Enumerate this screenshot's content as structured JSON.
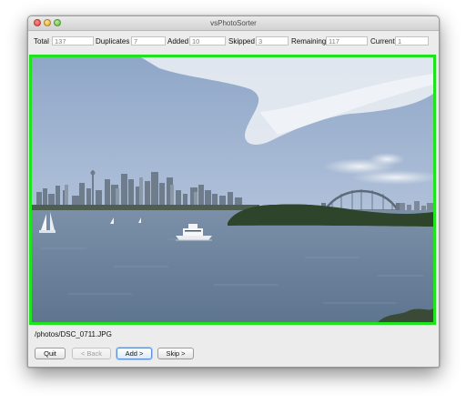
{
  "window": {
    "title": "vsPhotoSorter"
  },
  "stats": [
    {
      "label": "Total",
      "value": "137"
    },
    {
      "label": "Duplicates",
      "value": "7"
    },
    {
      "label": "Added",
      "value": "10"
    },
    {
      "label": "Skipped",
      "value": "3"
    },
    {
      "label": "Remaining",
      "value": "117"
    },
    {
      "label": "Current",
      "value": "1"
    }
  ],
  "photo": {
    "path": "/photos/DSC_0711.JPG",
    "border_color": "#1ee41e"
  },
  "buttons": {
    "quit": "Quit",
    "back": "< Back",
    "add": "Add >",
    "skip": "Skip >"
  }
}
